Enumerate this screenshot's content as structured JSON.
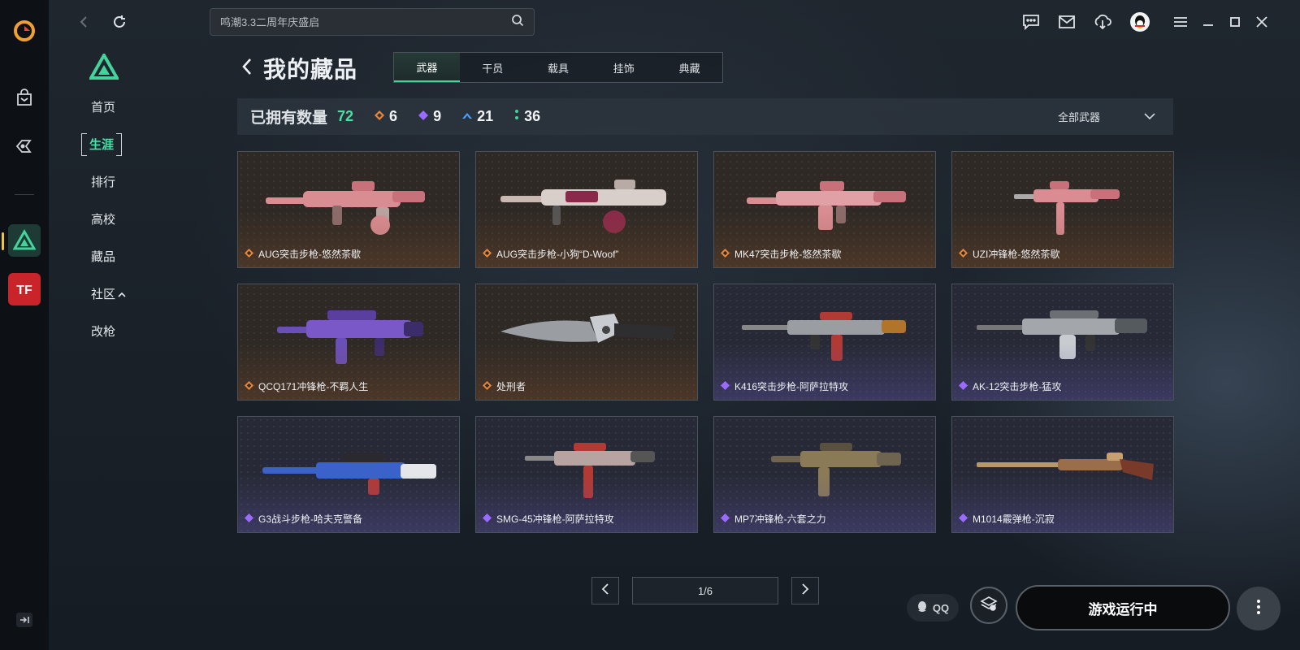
{
  "topbar": {
    "search_placeholder": "鸣潮3.3二周年庆盛启"
  },
  "subnav": {
    "items": [
      {
        "label": "首页",
        "active": false
      },
      {
        "label": "生涯",
        "active": true
      },
      {
        "label": "排行",
        "active": false
      },
      {
        "label": "高校",
        "active": false
      },
      {
        "label": "藏品",
        "active": false
      },
      {
        "label": "社区",
        "active": false,
        "has_chevron": true
      },
      {
        "label": "改枪",
        "active": false
      }
    ]
  },
  "header": {
    "title": "我的藏品",
    "tabs": [
      {
        "label": "武器",
        "active": true
      },
      {
        "label": "干员",
        "active": false
      },
      {
        "label": "载具",
        "active": false
      },
      {
        "label": "挂饰",
        "active": false
      },
      {
        "label": "典藏",
        "active": false
      }
    ]
  },
  "stats": {
    "owned_label": "已拥有数量",
    "owned_total": "72",
    "rarity_counts": [
      {
        "rarity": "orange",
        "color": "#e8873a",
        "count": "6"
      },
      {
        "rarity": "purple",
        "color": "#9b6bff",
        "count": "9"
      },
      {
        "rarity": "blue",
        "color": "#4aa2ff",
        "count": "21"
      },
      {
        "rarity": "green",
        "color": "#43d39b",
        "count": "36"
      }
    ],
    "filter_label": "全部武器"
  },
  "items": [
    {
      "name": "AUG突击步枪-悠然茶歇",
      "rarity": "orange",
      "accent": "#d98c92"
    },
    {
      "name": "AUG突击步枪-小狗“D-Woof”",
      "rarity": "orange",
      "accent": "#c9b8b2"
    },
    {
      "name": "MK47突击步枪-悠然茶歇",
      "rarity": "orange",
      "accent": "#d98c92"
    },
    {
      "name": "UZI冲锋枪-悠然茶歇",
      "rarity": "orange",
      "accent": "#d98c92"
    },
    {
      "name": "QCQ171冲锋枪-不羁人生",
      "rarity": "orange",
      "accent": "#7a58c8"
    },
    {
      "name": "处刑者",
      "rarity": "orange",
      "accent": "#9a9ea3"
    },
    {
      "name": "K416突击步枪-阿萨拉特攻",
      "rarity": "purple",
      "accent": "#b23a34"
    },
    {
      "name": "AK-12突击步枪-猛攻",
      "rarity": "purple",
      "accent": "#a3a7ab"
    },
    {
      "name": "G3战斗步枪-哈夫克警备",
      "rarity": "purple",
      "accent": "#3a62c9"
    },
    {
      "name": "SMG-45冲锋枪-阿萨拉特攻",
      "rarity": "purple",
      "accent": "#b23a34"
    },
    {
      "name": "MP7冲锋枪-六套之力",
      "rarity": "purple",
      "accent": "#8a7a55"
    },
    {
      "name": "M1014霰弹枪-沉寂",
      "rarity": "purple",
      "accent": "#9a6e4a"
    }
  ],
  "pager": {
    "text": "1/6"
  },
  "bottom": {
    "qq_label": "QQ",
    "run_label": "游戏运行中"
  }
}
